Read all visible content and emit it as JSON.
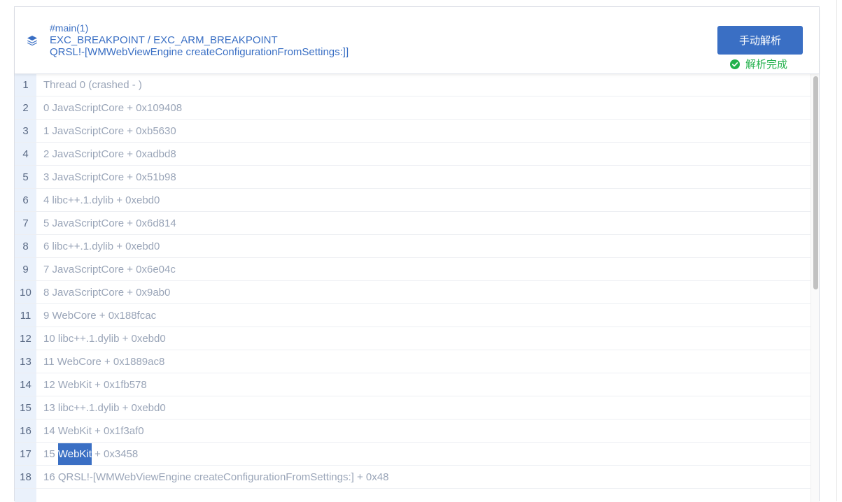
{
  "header": {
    "thread": "#main(1)",
    "exception": "EXC_BREAKPOINT / EXC_ARM_BREAKPOINT",
    "function": "QRSL!-[WMWebViewEngine createConfigurationFromSettings:]]",
    "icon": "layers-icon",
    "accent_color": "#3a6fc4"
  },
  "actions": {
    "parse_label": "手动解析",
    "status_label": "解析完成",
    "status_icon": "check-circle-icon",
    "status_color": "#22b14c"
  },
  "lines": [
    {
      "num": "1",
      "text": "Thread 0 (crashed - )"
    },
    {
      "num": "2",
      "text": "0 JavaScriptCore + 0x109408"
    },
    {
      "num": "3",
      "text": "1 JavaScriptCore + 0xb5630"
    },
    {
      "num": "4",
      "text": "2 JavaScriptCore + 0xadbd8"
    },
    {
      "num": "5",
      "text": "3 JavaScriptCore + 0x51b98"
    },
    {
      "num": "6",
      "text": "4 libc++.1.dylib + 0xebd0"
    },
    {
      "num": "7",
      "text": "5 JavaScriptCore + 0x6d814"
    },
    {
      "num": "8",
      "text": "6 libc++.1.dylib + 0xebd0"
    },
    {
      "num": "9",
      "text": "7 JavaScriptCore + 0x6e04c"
    },
    {
      "num": "10",
      "text": "8 JavaScriptCore + 0x9ab0"
    },
    {
      "num": "11",
      "text": "9 WebCore + 0x188fcac"
    },
    {
      "num": "12",
      "text": "10 libc++.1.dylib + 0xebd0"
    },
    {
      "num": "13",
      "text": "11 WebCore + 0x1889ac8"
    },
    {
      "num": "14",
      "text": "12 WebKit + 0x1fb578"
    },
    {
      "num": "15",
      "text": "13 libc++.1.dylib + 0xebd0"
    },
    {
      "num": "16",
      "text": "14 WebKit + 0x1f3af0"
    },
    {
      "num": "17",
      "pre": "15 ",
      "sel": "WebKit",
      "post": " + 0x3458"
    },
    {
      "num": "18",
      "text": "16 QRSL!-[WMWebViewEngine createConfigurationFromSettings:] + 0x48"
    }
  ]
}
